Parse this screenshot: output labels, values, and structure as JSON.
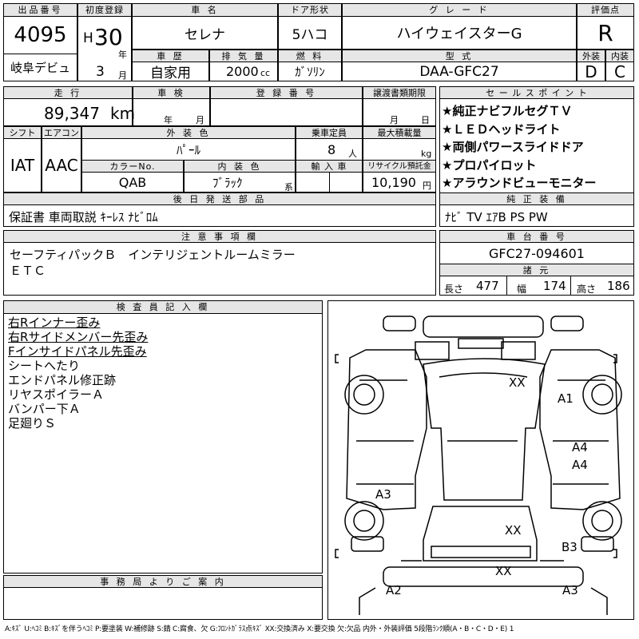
{
  "header": {
    "lot_label": "出品番号",
    "lot_number": "4095",
    "venue": "岐阜デビュ",
    "first_reg_label": "初度登録",
    "era": "H",
    "year": "30",
    "year_unit": "年",
    "month": "3",
    "month_unit": "月",
    "car_name_label": "車 名",
    "car_name": "セレナ",
    "door_label": "ドア形状",
    "door_type": "5ハコ",
    "grade_label": "グ レ ー ド",
    "grade": "ハイウェイスターG",
    "score_label": "評価点",
    "score": "R",
    "history_label": "車 歴",
    "history": "自家用",
    "displacement_label": "排 気 量",
    "displacement": "2000",
    "displacement_unit": "cc",
    "fuel_label": "燃 料",
    "fuel": "ｶﾞｿﾘﾝ",
    "model_code_label": "型 式",
    "model_code": "DAA-GFC27",
    "exterior_label": "外装",
    "exterior_grade": "D",
    "interior_label": "内装",
    "interior_grade": "C"
  },
  "row2": {
    "mileage_label": "走 行",
    "mileage": "89,347",
    "mileage_unit": "km",
    "inspection_label": "車 検",
    "insp_year_unit": "年",
    "insp_month_unit": "月",
    "reg_label": "登 録 番 号",
    "transfer_label": "譲渡書類期限",
    "transfer_month_unit": "月",
    "transfer_day_unit": "日",
    "shift_label": "シフト",
    "shift": "IAT",
    "ac_label": "エアコン",
    "ac": "AAC",
    "ext_color_label": "外 装 色",
    "ext_color": "ﾊﾟｰﾙ",
    "capacity_label": "乗車定員",
    "capacity": "8",
    "capacity_unit": "人",
    "max_load_label": "最大積載量",
    "max_load_unit": "kg",
    "color_no_label": "カラーNo.",
    "color_no": "QAB",
    "int_color_label": "内 装 色",
    "int_color": "ﾌﾞﾗｯｸ",
    "int_color_suffix": "系",
    "import_label": "輸 入 車",
    "recycle_label": "リサイクル預託金",
    "recycle": "10,190",
    "recycle_unit": "円",
    "later_items_label": "後 日 発 送 部 品",
    "later_items": "保証書 車両取説 ｷｰﾚｽ ﾅﾋﾞﾛﾑ",
    "sales_label": "セ ー ル ス ポ イ ン ト",
    "sales_points": [
      "★純正ナビフルセグＴＶ",
      "★ＬＥＤヘッドライト",
      "★両側パワースライドドア",
      "★プロパイロット",
      "★アラウンドビューモニター"
    ],
    "equip_label": "純 正 装 備",
    "equipment": "ﾅﾋﾞ TV ｴｱB PS PW"
  },
  "notes": {
    "caution_label": "注 意 事 項 欄",
    "caution_lines": [
      "セーフティパックＢ　インテリジェントルームミラー",
      "ＥＴＣ"
    ],
    "chassis_label": "車 台 番 号",
    "chassis": "GFC27-094601",
    "dims_label": "諸 元",
    "length_label": "長さ",
    "length": "477",
    "width_label": "幅",
    "width": "174",
    "height_label": "高さ",
    "height": "186"
  },
  "inspector": {
    "label": "検 査 員 記 入 欄",
    "lines": [
      "右Rインナー歪み",
      "右Rサイドメンバー先歪み",
      "Fインサイドパネル先歪み",
      "シートへたり",
      "エンドパネル修正跡",
      "リヤスポイラーＡ",
      "バンパー下Ａ",
      "足廻りＳ"
    ]
  },
  "diagram": {
    "marks": [
      "XX",
      "A1",
      "A4",
      "A4",
      "A3",
      "XX",
      "B3",
      "XX",
      "A2",
      "A3"
    ]
  },
  "office": {
    "label": "事 務 局 よ り ご 案 内"
  },
  "legend": "A:ｷｽﾞ U:ﾍｺﾐ B:ｷｽﾞを伴うﾍｺﾐ P:要塗装 W:補修跡 S:錆 C:腐食、欠 G:ﾌﾛﾝﾄｶﾞﾗｽ点ｷｽﾞ XX:交換済み X:要交換 欠:欠品 内外・外装評価 5段階ﾗﾝｸ順(A・B・C・D・E) 1"
}
